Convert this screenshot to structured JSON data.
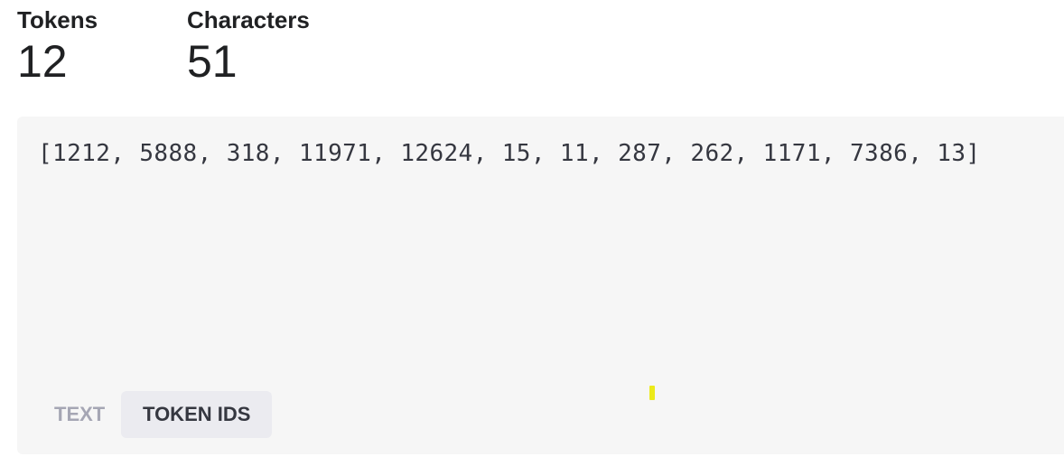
{
  "stats": {
    "tokens": {
      "label": "Tokens",
      "value": "12"
    },
    "characters": {
      "label": "Characters",
      "value": "51"
    }
  },
  "output": {
    "token_ids_text": "[1212, 5888, 318, 11971, 12624, 15, 11, 287, 262, 1171, 7386, 13]"
  },
  "tabs": [
    {
      "label": "TEXT",
      "active": false
    },
    {
      "label": "TOKEN IDS",
      "active": true
    }
  ],
  "colors": {
    "panel_bg": "#f6f6f6",
    "active_tab_bg": "#ebebf0",
    "inactive_tab_text": "#a5a6b4",
    "highlight_mark": "#ecea1a"
  }
}
